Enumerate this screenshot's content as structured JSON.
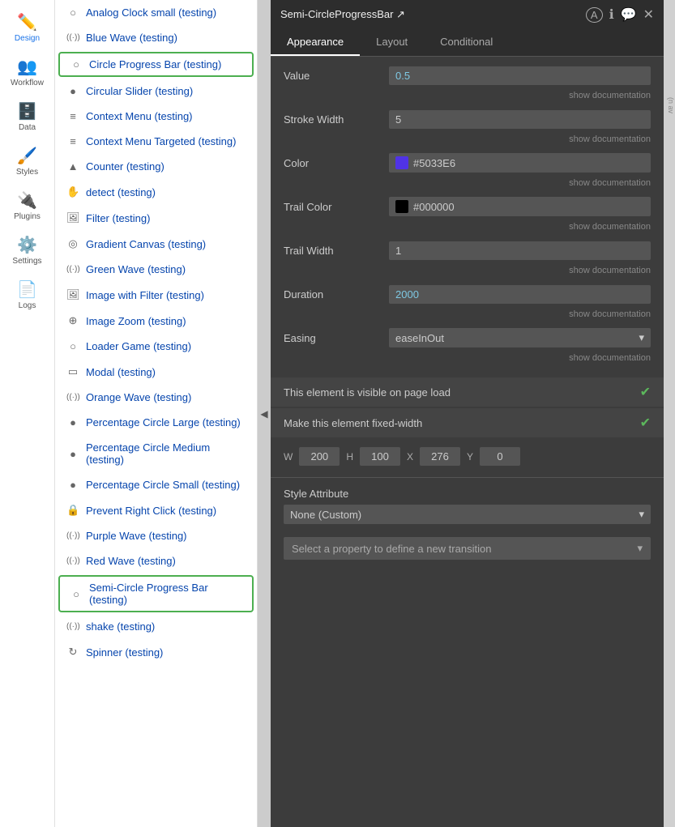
{
  "nav": {
    "items": [
      {
        "id": "design",
        "label": "Design",
        "icon": "✏️",
        "active": true
      },
      {
        "id": "workflow",
        "label": "Workflow",
        "icon": "👥"
      },
      {
        "id": "data",
        "label": "Data",
        "icon": "🗄️"
      },
      {
        "id": "styles",
        "label": "Styles",
        "icon": "🖌️"
      },
      {
        "id": "plugins",
        "label": "Plugins",
        "icon": "🔌"
      },
      {
        "id": "settings",
        "label": "Settings",
        "icon": "⚙️"
      },
      {
        "id": "logs",
        "label": "Logs",
        "icon": "📄"
      }
    ]
  },
  "components": [
    {
      "id": "analog-clock",
      "label": "Analog Clock small (testing)",
      "icon": "○"
    },
    {
      "id": "blue-wave",
      "label": "Blue Wave (testing)",
      "icon": "((·))"
    },
    {
      "id": "circle-progress",
      "label": "Circle Progress Bar (testing)",
      "icon": "○",
      "selected": true
    },
    {
      "id": "circular-slider",
      "label": "Circular Slider (testing)",
      "icon": "●"
    },
    {
      "id": "context-menu",
      "label": "Context Menu (testing)",
      "icon": "≡"
    },
    {
      "id": "context-menu-targeted",
      "label": "Context Menu Targeted (testing)",
      "icon": "≡"
    },
    {
      "id": "counter",
      "label": "Counter (testing)",
      "icon": "▲"
    },
    {
      "id": "detect",
      "label": "detect (testing)",
      "icon": "✋"
    },
    {
      "id": "filter",
      "label": "Filter (testing)",
      "icon": "🖼"
    },
    {
      "id": "gradient-canvas",
      "label": "Gradient Canvas (testing)",
      "icon": "◎"
    },
    {
      "id": "green-wave",
      "label": "Green Wave (testing)",
      "icon": "((·))"
    },
    {
      "id": "image-filter",
      "label": "Image with Filter (testing)",
      "icon": "🖼"
    },
    {
      "id": "image-zoom",
      "label": "Image Zoom (testing)",
      "icon": "⊕"
    },
    {
      "id": "loader-game",
      "label": "Loader Game (testing)",
      "icon": "○"
    },
    {
      "id": "modal",
      "label": "Modal (testing)",
      "icon": "▭"
    },
    {
      "id": "orange-wave",
      "label": "Orange Wave (testing)",
      "icon": "((·))"
    },
    {
      "id": "pct-large",
      "label": "Percentage Circle Large (testing)",
      "icon": "●"
    },
    {
      "id": "pct-medium",
      "label": "Percentage Circle Medium (testing)",
      "icon": "●"
    },
    {
      "id": "pct-small",
      "label": "Percentage Circle Small (testing)",
      "icon": "●"
    },
    {
      "id": "prevent-right",
      "label": "Prevent Right Click (testing)",
      "icon": "🔒"
    },
    {
      "id": "purple-wave",
      "label": "Purple Wave (testing)",
      "icon": "((·))"
    },
    {
      "id": "red-wave",
      "label": "Red Wave (testing)",
      "icon": "((·))"
    },
    {
      "id": "semi-circle",
      "label": "Semi-Circle Progress Bar (testing)",
      "icon": "○",
      "selected": true
    },
    {
      "id": "shake",
      "label": "shake (testing)",
      "icon": "((·))"
    },
    {
      "id": "spinner",
      "label": "Spinner (testing)",
      "icon": "↻"
    }
  ],
  "panel": {
    "title": "Semi-CircleProgressBar ↗",
    "tabs": [
      "Appearance",
      "Layout",
      "Conditional"
    ],
    "active_tab": "Appearance",
    "fields": {
      "value": {
        "label": "Value",
        "value": "0.5"
      },
      "stroke_width": {
        "label": "Stroke Width",
        "value": "5"
      },
      "color": {
        "label": "Color",
        "hex": "#5033E6",
        "swatch": "#5033e6"
      },
      "trail_color": {
        "label": "Trail Color",
        "hex": "#000000",
        "swatch": "#000000"
      },
      "trail_width": {
        "label": "Trail Width",
        "value": "1"
      },
      "duration": {
        "label": "Duration",
        "value": "2000"
      },
      "easing": {
        "label": "Easing",
        "value": "easeInOut"
      }
    },
    "checkboxes": {
      "visible_on_load": {
        "label": "This element is visible on page load",
        "checked": true
      },
      "fixed_width": {
        "label": "Make this element fixed-width",
        "checked": true
      }
    },
    "dimensions": {
      "w_label": "W",
      "w_value": "200",
      "h_label": "H",
      "h_value": "100",
      "x_label": "X",
      "x_value": "276",
      "y_label": "Y",
      "y_value": "0"
    },
    "style_attribute": {
      "label": "Style Attribute",
      "value": "None (Custom)"
    },
    "transition": {
      "placeholder": "Select a property to define a new transition"
    },
    "show_documentation": "show documentation"
  },
  "right_edge": {
    "text": "(n av"
  }
}
